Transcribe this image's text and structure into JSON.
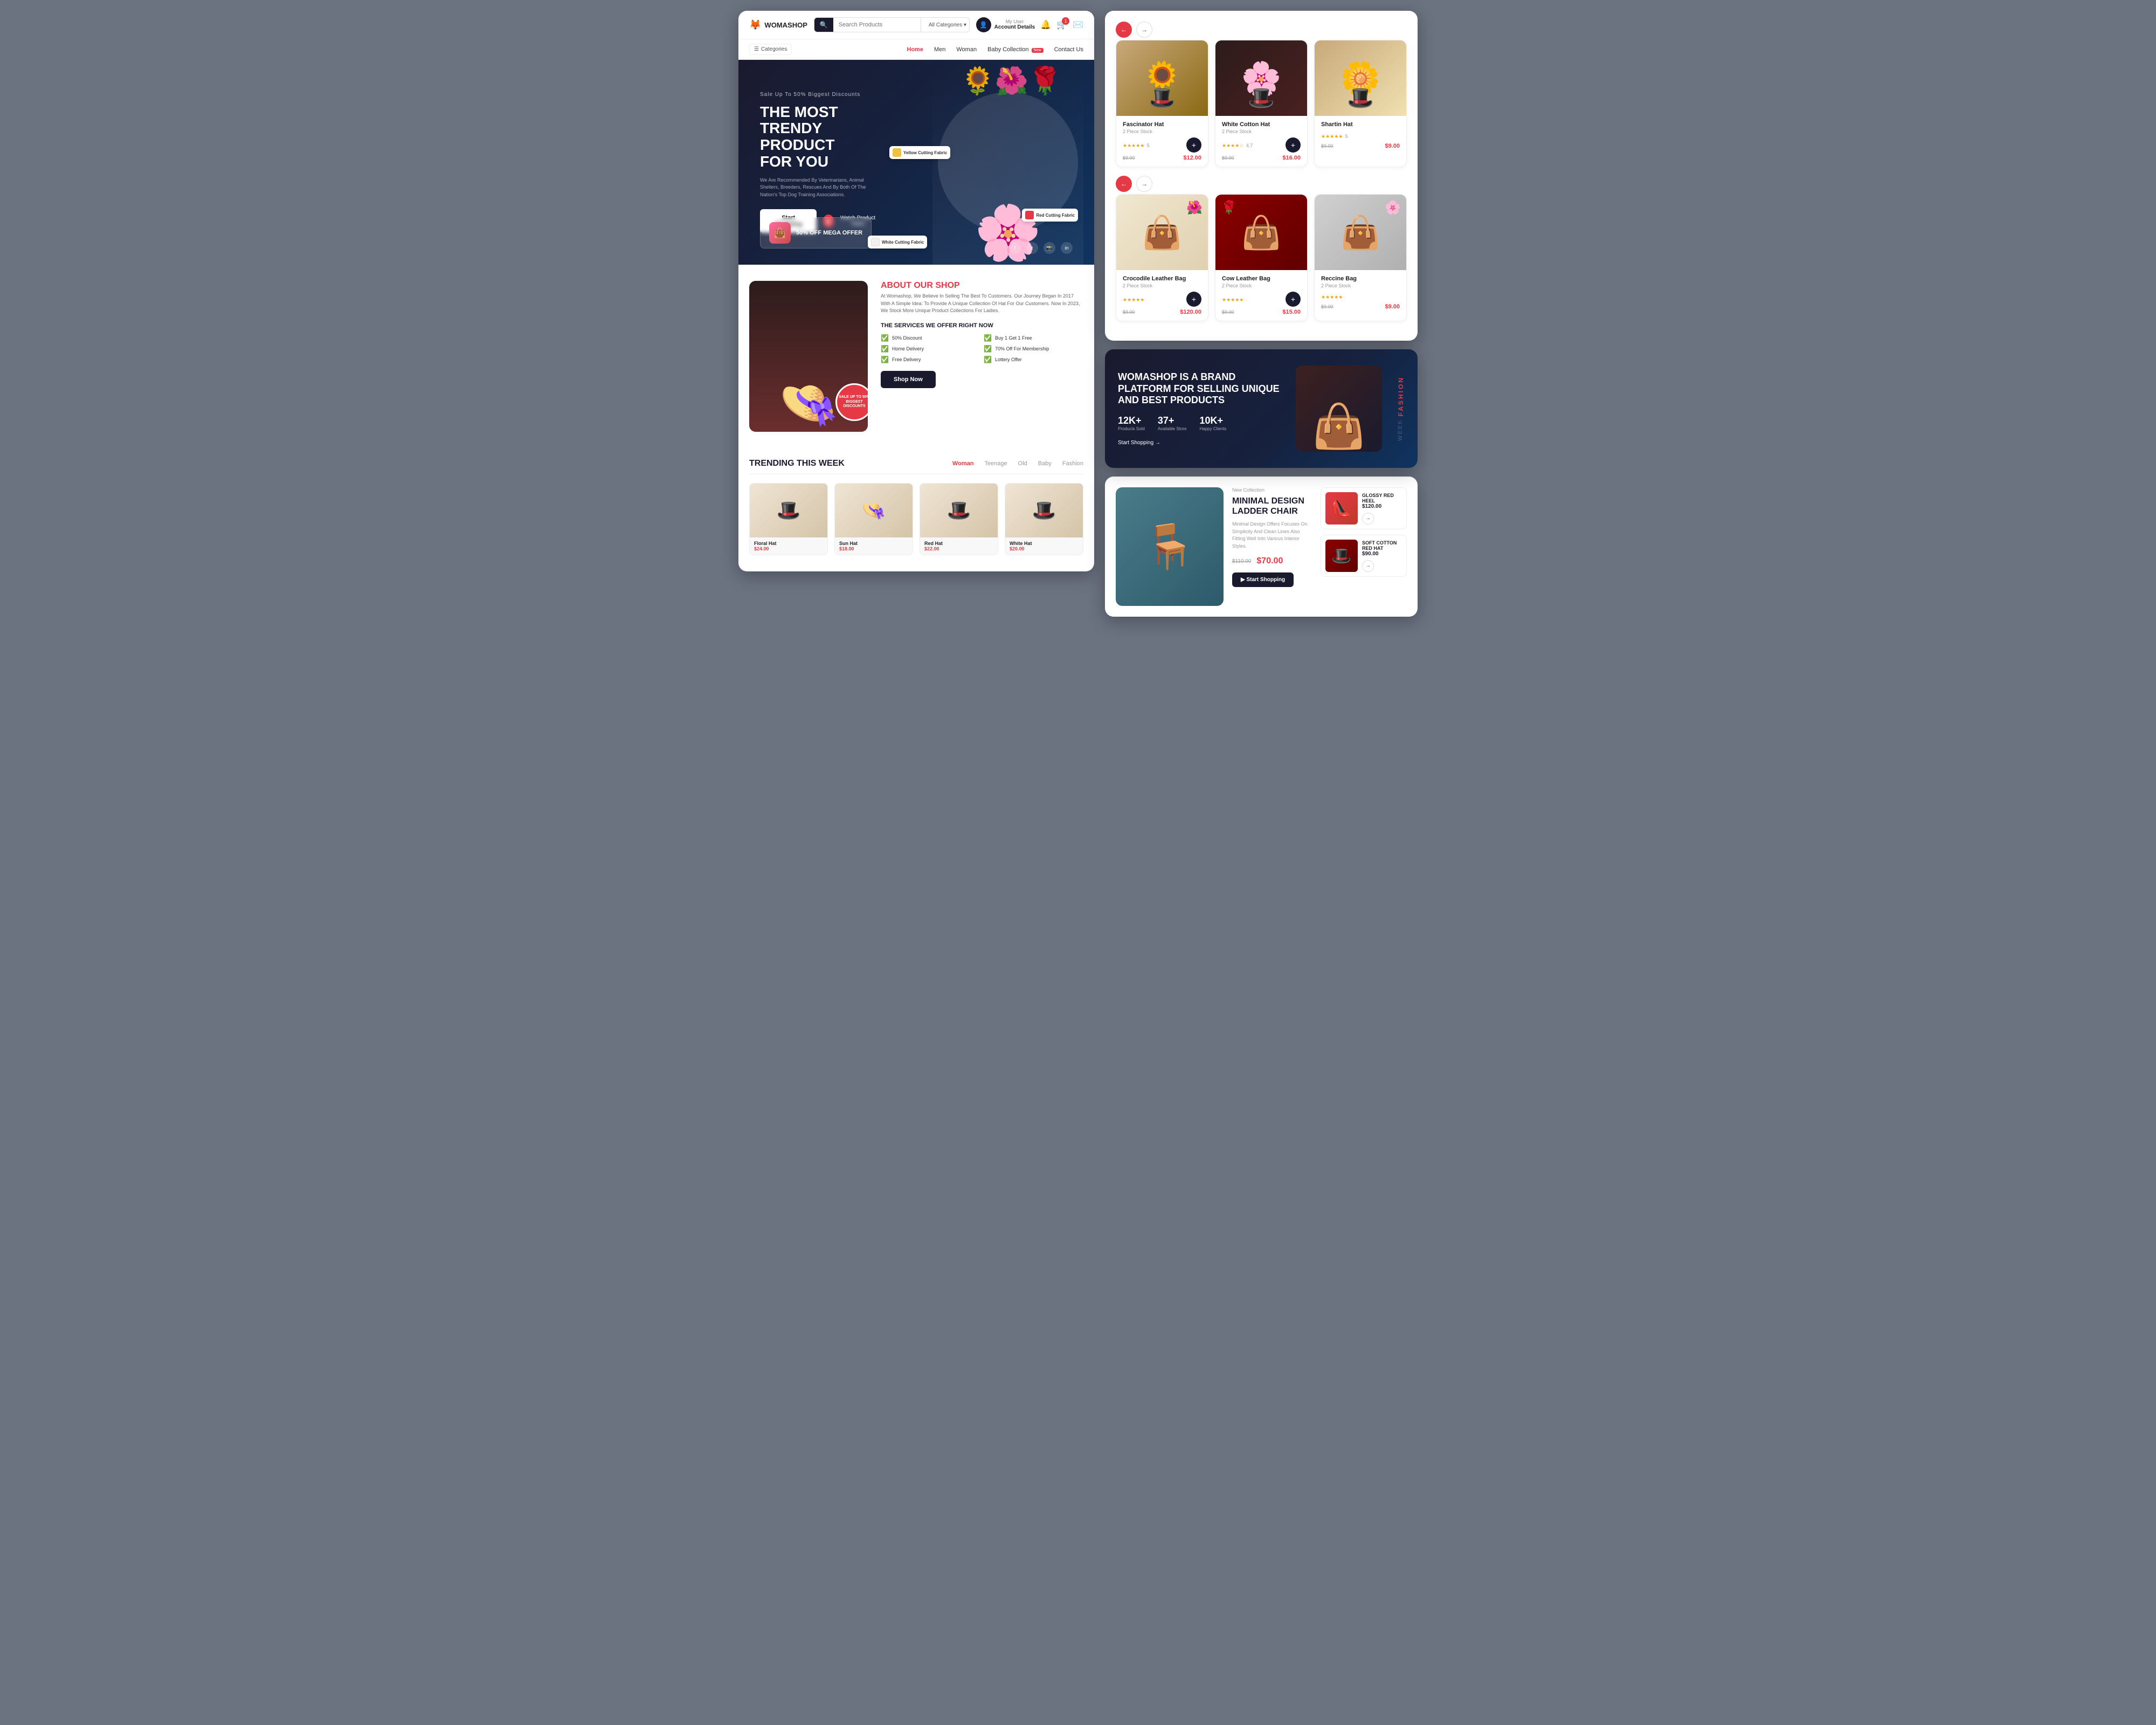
{
  "app": {
    "name": "WOMASHOP",
    "logo_icon": "🦊"
  },
  "header": {
    "search_placeholder": "Search Products",
    "category_default": "All Categories",
    "account_label": "My User",
    "account_detail": "Account Details",
    "cart_count": "1"
  },
  "nav": {
    "categories_label": "Categories",
    "links": [
      {
        "label": "Home",
        "active": true
      },
      {
        "label": "Men",
        "active": false
      },
      {
        "label": "Woman",
        "active": false
      },
      {
        "label": "Baby Collection",
        "active": false,
        "badge": "New"
      },
      {
        "label": "Contact Us",
        "active": false
      }
    ]
  },
  "hero": {
    "subtitle": "Sale Up To 50% Biggest Discounts",
    "title_line1": "THE MOST",
    "title_line2": "TRENDY PRODUCT",
    "title_line3": "FOR YOU",
    "desc": "We Are Recommended By Veterinarians, Animal Shelters, Breeders, Rescues And By Both Of The Nation's Top Dog Training Associations.",
    "btn_start": "Start Shopping",
    "btn_watch": "Watch Product Video",
    "offer_badge": "50% OFF MEGA OFFER",
    "thumb1_label": "Yellow Cutting Fabric",
    "thumb2_label": "Red Cutting Fabric",
    "thumb3_label": "White Cutting Fabric"
  },
  "about": {
    "title": "ABOUT OUR",
    "title_highlight": "SHOP",
    "desc": "At Womashop, We Believe In Selling The Best To Customers. Our Journey Began In 2017 With A Simple Idea: To Provide A Unique Collection Of Hat For Our Customers. Now In 2023, We Stock More Unique Product Collections For Ladies.",
    "services_title": "THE SERVICES WE OFFER RIGHT NOW",
    "services": [
      {
        "label": "50% Discount"
      },
      {
        "label": "Buy 1 Get 1 Free"
      },
      {
        "label": "Home Delivery"
      },
      {
        "label": "70% Off For Membership"
      },
      {
        "label": "Free Delivery"
      },
      {
        "label": "Lottery Offer"
      }
    ],
    "btn_label": "Shop Now",
    "sale_badge": "SALE UP TO 50% BIGGEST DISCOUNTS"
  },
  "trending": {
    "title": "TRENDING THIS WEEK",
    "tabs": [
      {
        "label": "Woman",
        "active": true
      },
      {
        "label": "Teenage",
        "active": false
      },
      {
        "label": "Old",
        "active": false
      },
      {
        "label": "Baby",
        "active": false
      },
      {
        "label": "Fashion",
        "active": false
      }
    ],
    "products": [
      {
        "name": "Floral Hat",
        "price": "$24.00",
        "icon": "🎩"
      },
      {
        "name": "Sun Hat",
        "price": "$18.00",
        "icon": "👒"
      },
      {
        "name": "Red Hat",
        "price": "$22.00",
        "icon": "🎩"
      },
      {
        "name": "White Hat",
        "price": "$20.00",
        "icon": "🎩"
      }
    ]
  },
  "products": {
    "hats": [
      {
        "name": "Fascinator Hat",
        "sub": "2 Piece Stock",
        "price_old": "$9.00",
        "price_new": "$12.00",
        "stars": "5",
        "style": "hat1"
      },
      {
        "name": "White Cotton Hat",
        "sub": "2 Piece Stock",
        "price_old": "$9.00",
        "price_new": "$16.00",
        "stars": "4.7",
        "style": "hat2"
      },
      {
        "name": "Shartin Hat",
        "sub": "",
        "price_old": "$9.00",
        "price_new": "$9.00",
        "stars": "5",
        "style": "hat3"
      }
    ],
    "bags": [
      {
        "name": "Crocodile Leather Bag",
        "sub": "2 Piece Stock",
        "price_old": "$9.00",
        "price_new": "$120.00",
        "stars": "5",
        "style": "bag1"
      },
      {
        "name": "Cow Leather Bag",
        "sub": "2 Piece Stock",
        "price_old": "$9.00",
        "price_new": "$15.00",
        "stars": "5",
        "style": "bag2"
      },
      {
        "name": "Reccine Bag",
        "sub": "2 Piece Stock",
        "price_old": "$9.00",
        "price_new": "$9.00",
        "stars": "5",
        "style": "bag3"
      }
    ]
  },
  "brand": {
    "title": "WOMASHOP IS A BRAND PLATFORM FOR SELLING UNIQUE AND BEST PRODUCTS",
    "stats": [
      {
        "num": "12K+",
        "label": "Products Sold"
      },
      {
        "num": "37+",
        "label": "Available Store"
      },
      {
        "num": "10K+",
        "label": "Happy Clients"
      }
    ],
    "cta": "Start Shopping →",
    "fashion_label": "FASHION",
    "week_label": "WEEK"
  },
  "shop": {
    "new_collection": "New Collection",
    "product_title": "MINIMAL DESIGN LADDER CHAIR",
    "product_desc": "Minimal Design Offers Focuses On Simplicity And Clean Lines Also Fitting Well Into Various Interior Styles.",
    "price_old": "$110.00",
    "price_new": "$70.00",
    "btn_label": "▶ Start Shopping",
    "sidebar_products": [
      {
        "name": "GLOSSY RED HEEL",
        "price": "$120.00",
        "style": "red"
      },
      {
        "name": "SOFT COTTON RED HAT",
        "price": "$90.00",
        "style": "hat-red"
      }
    ]
  }
}
